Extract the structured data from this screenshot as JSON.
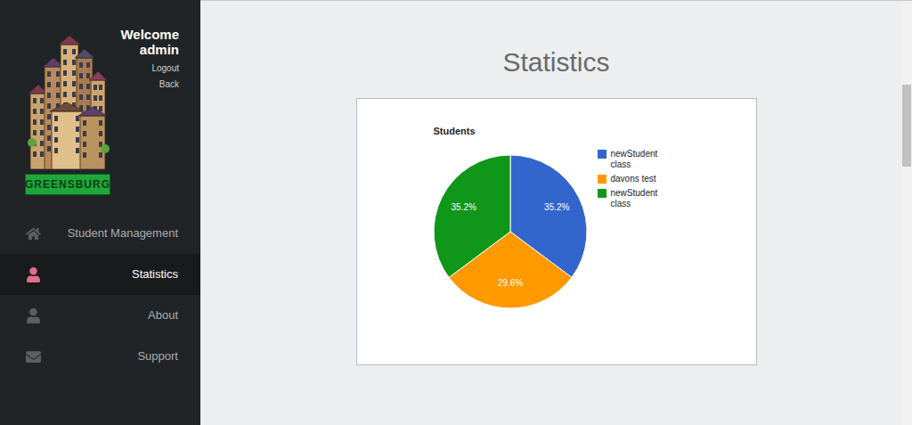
{
  "sidebar": {
    "logo": {
      "banner": "GREENSBURG"
    },
    "welcome": "Welcome",
    "user": "admin",
    "links": [
      "Logout",
      "Back"
    ],
    "items": [
      {
        "label": "Student Management",
        "selected": false,
        "kind": "home"
      },
      {
        "label": "Statistics",
        "selected": true,
        "kind": "user"
      },
      {
        "label": "About",
        "selected": false,
        "kind": "user"
      },
      {
        "label": "Support",
        "selected": false,
        "kind": "mail"
      }
    ]
  },
  "page": {
    "title": "Statistics"
  },
  "chart": {
    "title": "Students",
    "series": [
      {
        "label": "newStudent class",
        "value": 35.2,
        "display": "35.2%",
        "color": "#3366cc"
      },
      {
        "label": "davons test",
        "value": 29.6,
        "display": "29.6%",
        "color": "#ff9900"
      },
      {
        "label": "newStudent class",
        "value": 35.2,
        "display": "35.2%",
        "color": "#109618"
      }
    ]
  }
}
